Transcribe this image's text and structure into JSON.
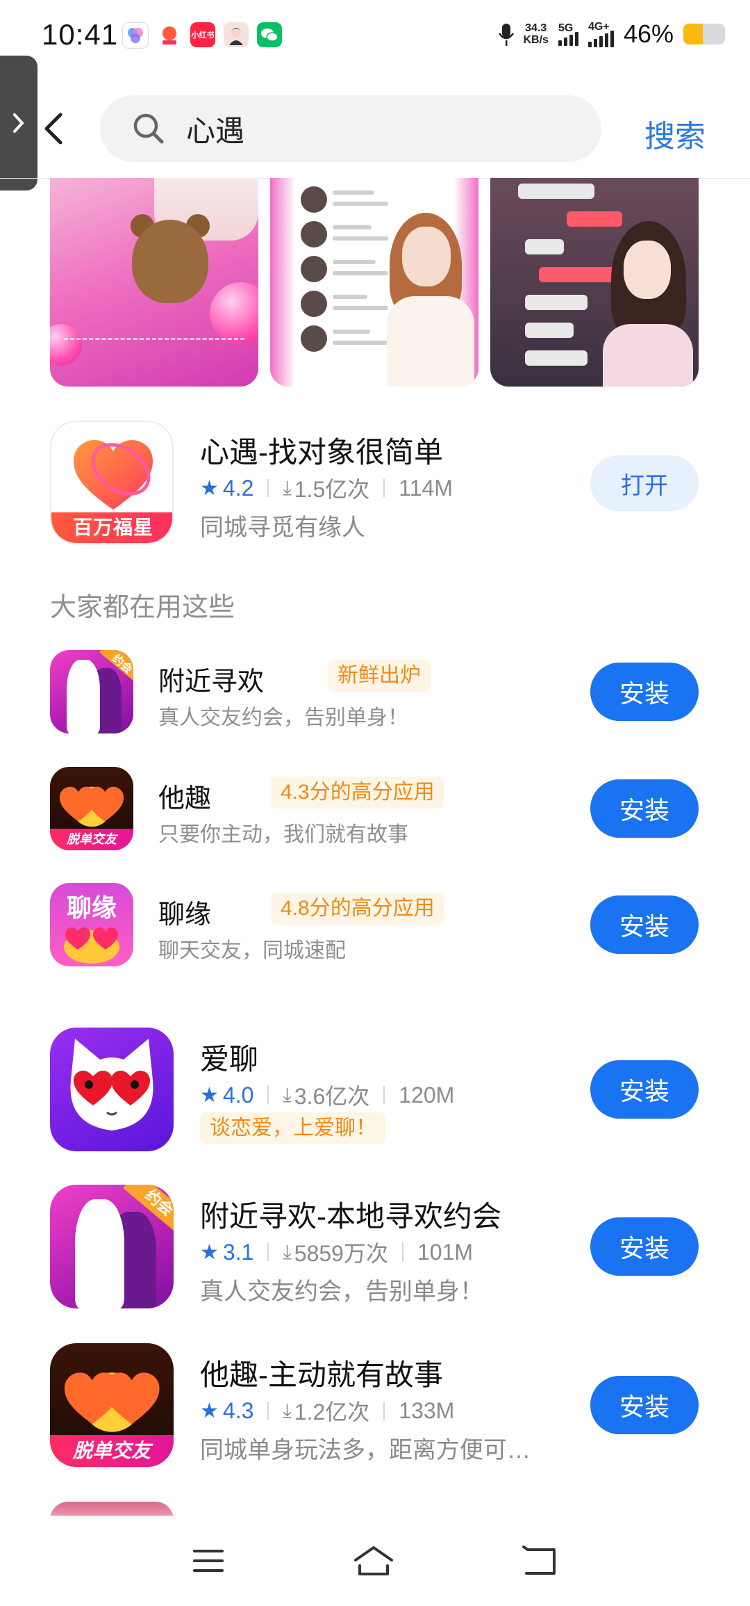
{
  "status_bar": {
    "time": "10:41",
    "net_speed_value": "34.3",
    "net_speed_unit": "KB/s",
    "sig1_label": "5G",
    "sig2_label": "4G+",
    "battery_text": "46%",
    "battery_level": 0.46,
    "notification_icons": [
      "app-store-icon",
      "red-app-icon",
      "xiaohongshu-icon",
      "avatar-app-icon",
      "wechat-icon"
    ],
    "notif_xhs_label": "小红书"
  },
  "search": {
    "query": "心遇",
    "button_label": "搜索"
  },
  "main_app": {
    "title": "心遇-找对象很简单",
    "rating": "4.2",
    "downloads": "1.5亿次",
    "size": "114M",
    "description": "同城寻觅有缘人",
    "icon_banner": "百万福星",
    "button_label": "打开"
  },
  "section": {
    "title": "大家都在用这些"
  },
  "recommended": [
    {
      "name": "附近寻欢",
      "badge": "新鲜出炉",
      "description": "真人交友约会，告别单身！",
      "button_label": "安装",
      "icon_tag": "约会"
    },
    {
      "name": "他趣",
      "badge": "4.3分的高分应用",
      "description": "只要你主动，我们就有故事",
      "button_label": "安装",
      "icon_banner": "脱单交友"
    },
    {
      "name": "聊缘",
      "badge": "4.8分的高分应用",
      "description": "聊天交友，同城速配",
      "button_label": "安装",
      "icon_text": "聊缘"
    }
  ],
  "results": [
    {
      "title": "爱聊",
      "rating": "4.0",
      "downloads": "3.6亿次",
      "size": "120M",
      "badge": "谈恋爱，上爱聊！",
      "button_label": "安装"
    },
    {
      "title": "附近寻欢-本地寻欢约会",
      "rating": "3.1",
      "downloads": "5859万次",
      "size": "101M",
      "description": "真人交友约会，告别单身！",
      "button_label": "安装",
      "icon_tag": "约会"
    },
    {
      "title": "他趣-主动就有故事",
      "rating": "4.3",
      "downloads": "1.2亿次",
      "size": "133M",
      "description": "同城单身玩法多，距离方便可…",
      "button_label": "安装",
      "icon_banner": "脱单交友"
    }
  ],
  "colors": {
    "accent": "#1a73f0",
    "search_button": "#2a7ae4",
    "badge_text": "#f08a16",
    "badge_bg": "#fff5e6",
    "rating_blue": "#2a6fe0"
  }
}
